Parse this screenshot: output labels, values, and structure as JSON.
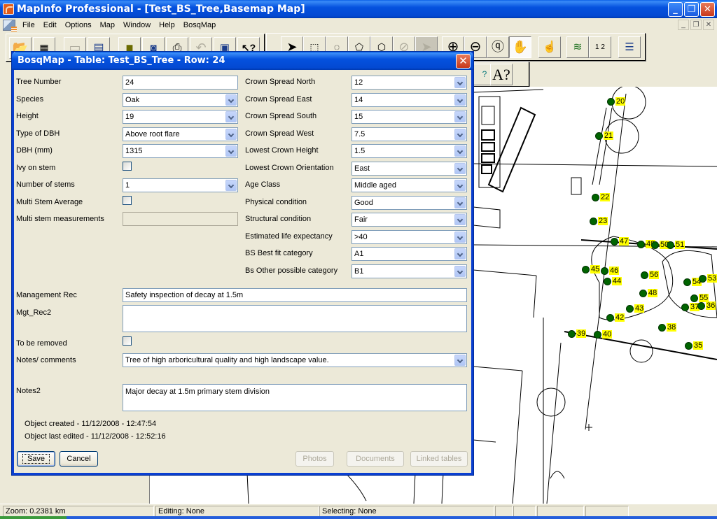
{
  "app": {
    "title": "MapInfo Professional - [Test_BS_Tree,Basemap Map]",
    "window_buttons": [
      "minimize",
      "restore",
      "close"
    ]
  },
  "menu": {
    "items": [
      "File",
      "Edit",
      "Options",
      "Map",
      "Window",
      "Help",
      "BosqMap"
    ]
  },
  "toolbars": {
    "main": [
      "open-table",
      "open-workspace",
      "save-table",
      "new-browser",
      "open-folder",
      "new-map",
      "print",
      "undo",
      "layout",
      "help-pointer"
    ],
    "drawing": [
      "select",
      "marquee-select",
      "radius-select",
      "polygon-select",
      "boundary-select",
      "unselect-all",
      "graph-select",
      "zoom-in",
      "zoom-out",
      "change-view",
      "grabber",
      "info",
      "layer-control",
      "ruler",
      "legend"
    ],
    "extra": [
      "region-info",
      "label-info"
    ],
    "extra_glyphs": [
      "?",
      "A?"
    ]
  },
  "dialog": {
    "title": "BosqMap - Table: Test_BS_Tree - Row: 24",
    "left_fields": [
      {
        "label": "Tree Number",
        "value": "24",
        "type": "text"
      },
      {
        "label": "Species",
        "value": "Oak",
        "type": "combo"
      },
      {
        "label": "Height",
        "value": "19",
        "type": "combo"
      },
      {
        "label": "Type of DBH",
        "value": "Above root flare",
        "type": "combo"
      },
      {
        "label": "DBH (mm)",
        "value": "1315",
        "type": "combo"
      },
      {
        "label": "Ivy on stem",
        "value": false,
        "type": "checkbox"
      },
      {
        "label": "Number of stems",
        "value": "1",
        "type": "combo"
      },
      {
        "label": "Multi Stem Average",
        "value": false,
        "type": "checkbox"
      },
      {
        "label": "Multi stem measurements",
        "value": "",
        "type": "disabled"
      }
    ],
    "right_fields": [
      {
        "label": "Crown Spread North",
        "value": "12"
      },
      {
        "label": "Crown Spread East",
        "value": "14"
      },
      {
        "label": "Crown Spread South",
        "value": "15"
      },
      {
        "label": "Crown Spread West",
        "value": "7.5"
      },
      {
        "label": "Lowest Crown Height",
        "value": "1.5"
      },
      {
        "label": "Lowest Crown Orientation",
        "value": "East"
      },
      {
        "label": "Age Class",
        "value": "Middle aged"
      },
      {
        "label": "Physical condition",
        "value": "Good"
      },
      {
        "label": "Structural condition",
        "value": "Fair"
      },
      {
        "label": "Estimated life expectancy",
        "value": ">40"
      },
      {
        "label": "BS Best fit category",
        "value": "A1"
      },
      {
        "label": "Bs Other possible category",
        "value": "B1"
      }
    ],
    "management_rec": {
      "label": "Management Rec",
      "value": "Safety inspection of decay at 1.5m"
    },
    "mgt_rec2": {
      "label": "Mgt_Rec2",
      "value": ""
    },
    "to_be_removed": {
      "label": "To be removed",
      "value": false
    },
    "notes_comments": {
      "label": "Notes/ comments",
      "value": "Tree of high arboricultural quality and high landscape value."
    },
    "notes2": {
      "label": "Notes2",
      "value": "Major decay at 1.5m primary  stem division"
    },
    "created": "Object created - 11/12/2008 - 12:47:54",
    "edited": "Object last edited - 11/12/2008 - 12:52:16",
    "buttons": {
      "save": "Save",
      "cancel": "Cancel",
      "photos": "Photos",
      "documents": "Documents",
      "linked_tables": "Linked tables"
    }
  },
  "map": {
    "tree_color": "#006400",
    "label_color": "#ffff00",
    "trees": [
      {
        "id": "20"
      },
      {
        "id": "21"
      },
      {
        "id": "22"
      },
      {
        "id": "23"
      },
      {
        "id": "47"
      },
      {
        "id": "49"
      },
      {
        "id": "50"
      },
      {
        "id": "51"
      },
      {
        "id": "45"
      },
      {
        "id": "46"
      },
      {
        "id": "44"
      },
      {
        "id": "56"
      },
      {
        "id": "54"
      },
      {
        "id": "53"
      },
      {
        "id": "48"
      },
      {
        "id": "55"
      },
      {
        "id": "43"
      },
      {
        "id": "37"
      },
      {
        "id": "36"
      },
      {
        "id": "42"
      },
      {
        "id": "38"
      },
      {
        "id": "39"
      },
      {
        "id": "40"
      },
      {
        "id": "35"
      }
    ]
  },
  "statusbar": {
    "zoom": "Zoom: 0.2381 km",
    "editing": "Editing: None",
    "selecting": "Selecting: None"
  }
}
